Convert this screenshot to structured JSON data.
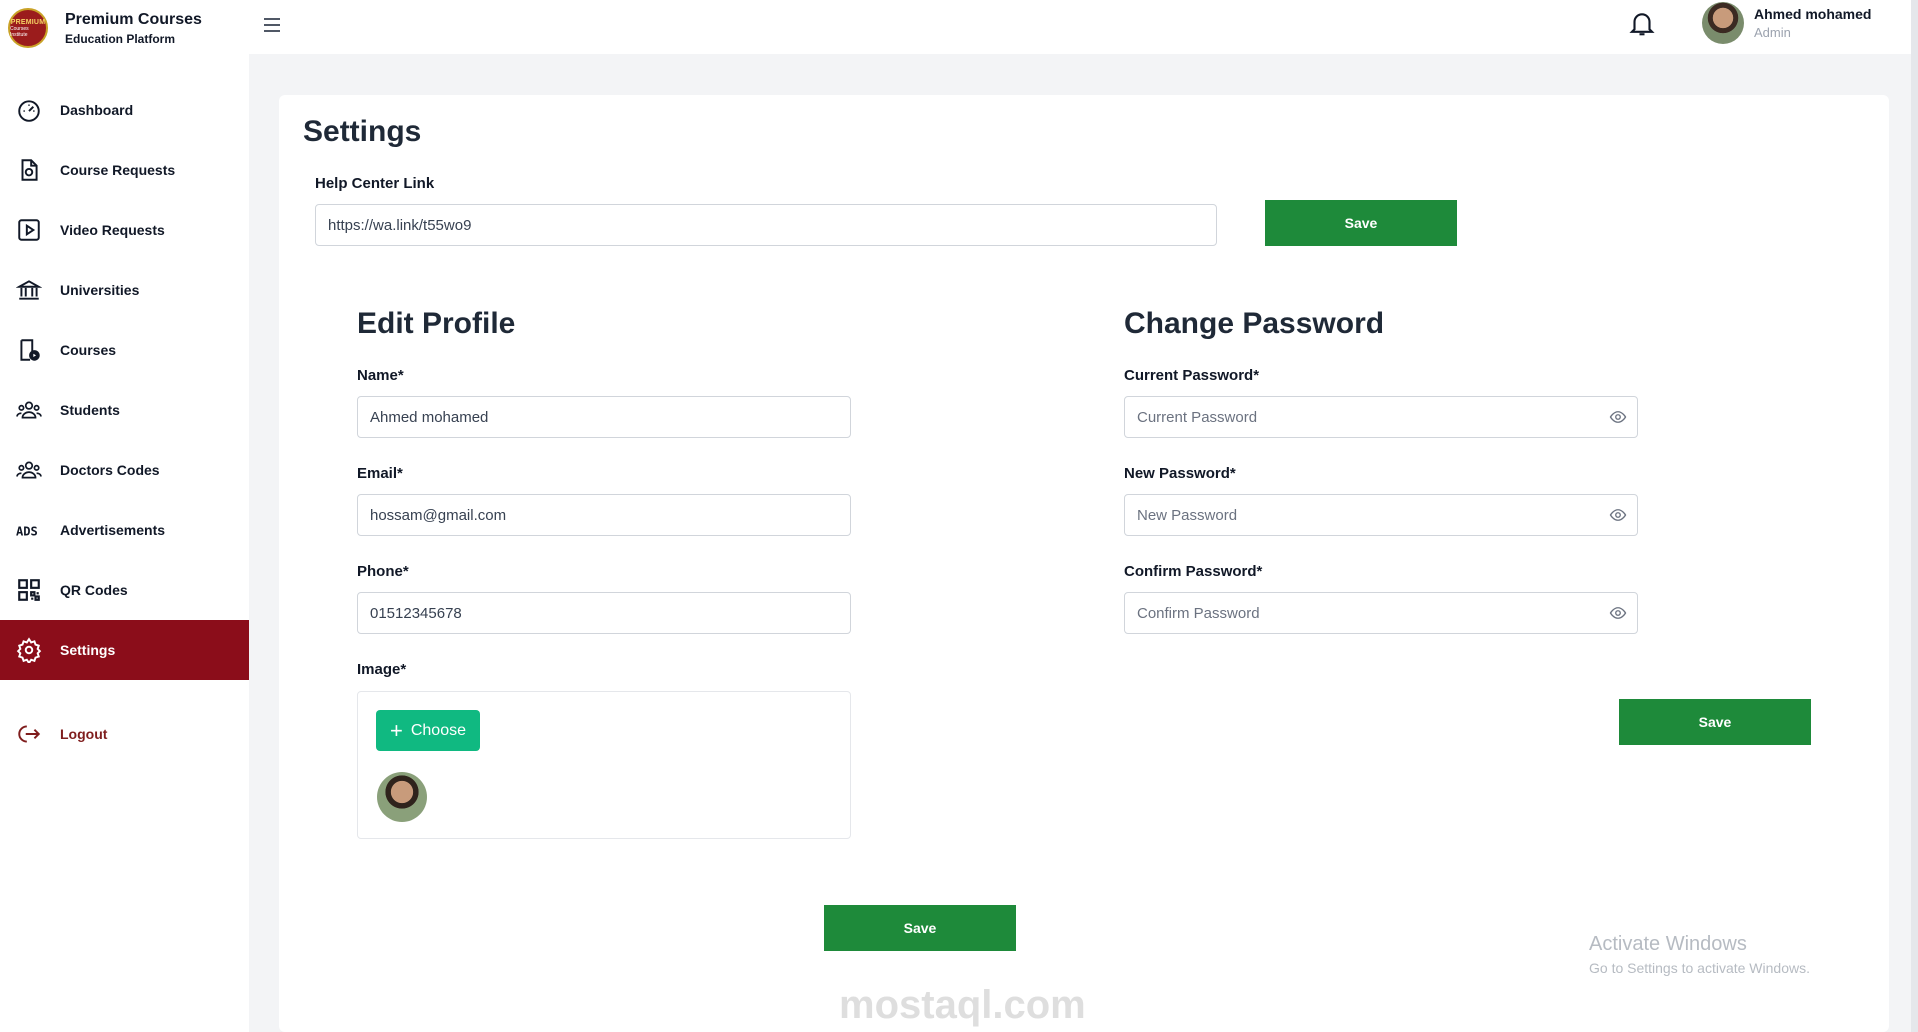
{
  "brand": {
    "title": "Premium Courses",
    "subtitle": "Education Platform",
    "logo_line1": "PREMIUM",
    "logo_line2": "Courses Institute"
  },
  "sidebar": {
    "items": [
      {
        "label": "Dashboard",
        "icon": "dashboard-gauge-icon"
      },
      {
        "label": "Course Requests",
        "icon": "document-icon"
      },
      {
        "label": "Video Requests",
        "icon": "video-play-icon"
      },
      {
        "label": "Universities",
        "icon": "institution-icon"
      },
      {
        "label": "Courses",
        "icon": "course-file-icon"
      },
      {
        "label": "Students",
        "icon": "students-group-icon"
      },
      {
        "label": "Doctors Codes",
        "icon": "doctors-group-icon"
      },
      {
        "label": "Advertisements",
        "icon": "ads-icon"
      },
      {
        "label": "QR Codes",
        "icon": "qr-code-icon"
      },
      {
        "label": "Settings",
        "icon": "gear-icon",
        "active": true
      }
    ],
    "logout_label": "Logout"
  },
  "header": {
    "user_name": "Ahmed mohamed",
    "user_role": "Admin"
  },
  "settings": {
    "title": "Settings",
    "help_center_label": "Help Center Link",
    "help_center_value": "https://wa.link/t55wo9",
    "save_label": "Save"
  },
  "profile": {
    "title": "Edit Profile",
    "name_label": "Name*",
    "name_value": "Ahmed mohamed",
    "email_label": "Email*",
    "email_value": "hossam@gmail.com",
    "phone_label": "Phone*",
    "phone_value": "01512345678",
    "image_label": "Image*",
    "choose_label": "Choose",
    "save_label": "Save"
  },
  "password": {
    "title": "Change Password",
    "current_label": "Current Password*",
    "current_placeholder": "Current Password",
    "new_label": "New Password*",
    "new_placeholder": "New Password",
    "confirm_label": "Confirm Password*",
    "confirm_placeholder": "Confirm Password",
    "save_label": "Save"
  },
  "overlay": {
    "activate_title": "Activate Windows",
    "activate_sub": "Go to Settings to activate Windows.",
    "watermark": "mostaql.com"
  },
  "colors": {
    "accent_red": "#8b0d1a",
    "save_green": "#1e8a3a",
    "choose_green": "#10b981"
  }
}
